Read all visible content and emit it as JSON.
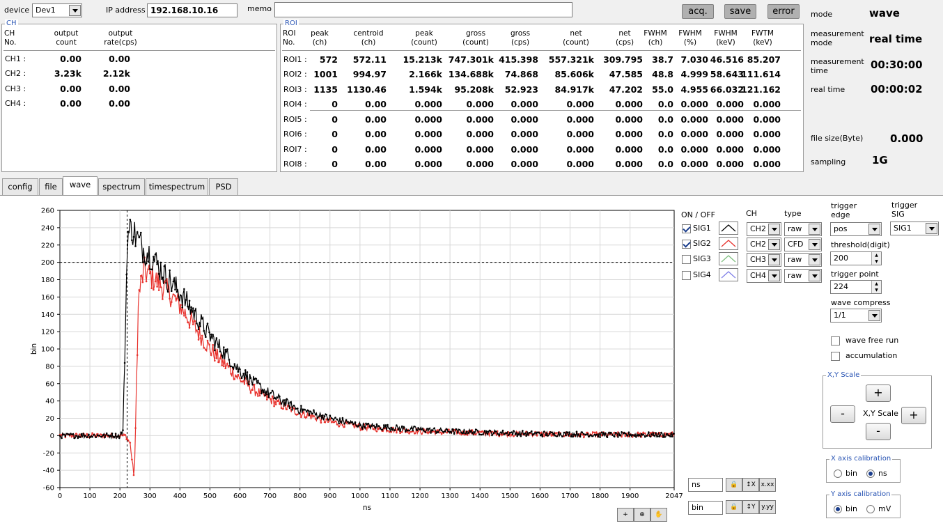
{
  "top": {
    "device_label": "device",
    "device_value": "Dev1",
    "ip_label": "IP address",
    "ip_value": "192.168.10.16",
    "memo_label": "memo",
    "memo_value": "",
    "acq_label": "acq.",
    "save_label": "save",
    "error_label": "error"
  },
  "ch_panel": {
    "title": "CH",
    "h_no": "CH\nNo.",
    "h_count": "output\ncount",
    "h_rate": "output\nrate(cps)",
    "rows": [
      {
        "name": "CH1 :",
        "count": "0.00",
        "rate": "0.00"
      },
      {
        "name": "CH2 :",
        "count": "3.23k",
        "rate": "2.12k"
      },
      {
        "name": "CH3 :",
        "count": "0.00",
        "rate": "0.00"
      },
      {
        "name": "CH4 :",
        "count": "0.00",
        "rate": "0.00"
      }
    ]
  },
  "roi_panel": {
    "title": "ROI",
    "headers": [
      "ROI\nNo.",
      "peak\n(ch)",
      "centroid\n(ch)",
      "peak\n(count)",
      "gross\n(count)",
      "gross\n(cps)",
      "net\n(count)",
      "net\n(cps)",
      "FWHM\n(ch)",
      "FWHM\n(%)",
      "FWHM\n(keV)",
      "FWTM\n(keV)"
    ],
    "rows": [
      [
        "ROI1 :",
        "572",
        "572.11",
        "15.213k",
        "747.301k",
        "415.398",
        "557.321k",
        "309.795",
        "38.7",
        "7.030",
        "46.516",
        "85.207"
      ],
      [
        "ROI2 :",
        "1001",
        "994.97",
        "2.166k",
        "134.688k",
        "74.868",
        "85.606k",
        "47.585",
        "48.8",
        "4.999",
        "58.643",
        "111.614"
      ],
      [
        "ROI3 :",
        "1135",
        "1130.46",
        "1.594k",
        "95.208k",
        "52.923",
        "84.917k",
        "47.202",
        "55.0",
        "4.955",
        "66.032",
        "121.162"
      ],
      [
        "ROI4 :",
        "0",
        "0.00",
        "0.000",
        "0.000",
        "0.000",
        "0.000",
        "0.000",
        "0.0",
        "0.000",
        "0.000",
        "0.000"
      ],
      [
        "ROI5 :",
        "0",
        "0.00",
        "0.000",
        "0.000",
        "0.000",
        "0.000",
        "0.000",
        "0.0",
        "0.000",
        "0.000",
        "0.000"
      ],
      [
        "ROI6 :",
        "0",
        "0.00",
        "0.000",
        "0.000",
        "0.000",
        "0.000",
        "0.000",
        "0.0",
        "0.000",
        "0.000",
        "0.000"
      ],
      [
        "ROI7 :",
        "0",
        "0.00",
        "0.000",
        "0.000",
        "0.000",
        "0.000",
        "0.000",
        "0.0",
        "0.000",
        "0.000",
        "0.000"
      ],
      [
        "ROI8 :",
        "0",
        "0.00",
        "0.000",
        "0.000",
        "0.000",
        "0.000",
        "0.000",
        "0.0",
        "0.000",
        "0.000",
        "0.000"
      ]
    ]
  },
  "status": {
    "mode_label": "mode",
    "mode_value": "wave",
    "meas_mode_label": "measurement\nmode",
    "meas_mode_value": "real time",
    "meas_time_label": "measurement\ntime",
    "meas_time_value": "00:30:00",
    "real_time_label": "real time",
    "real_time_value": "00:00:02",
    "file_size_label": "file size(Byte)",
    "file_size_value": "0.000",
    "sampling_label": "sampling",
    "sampling_value": "1G"
  },
  "tabs": [
    "config",
    "file",
    "wave",
    "spectrum",
    "timespectrum",
    "PSD"
  ],
  "active_tab": "wave",
  "signals": {
    "onoff_label": "ON / OFF",
    "ch_label": "CH",
    "type_label": "type",
    "rows": [
      {
        "name": "SIG1",
        "checked": true,
        "color": "#000000",
        "ch": "CH2",
        "type": "raw"
      },
      {
        "name": "SIG2",
        "checked": true,
        "color": "#e8322d",
        "ch": "CH2",
        "type": "CFD"
      },
      {
        "name": "SIG3",
        "checked": false,
        "color": "#7fbf7f",
        "ch": "CH3",
        "type": "raw"
      },
      {
        "name": "SIG4",
        "checked": false,
        "color": "#8080e8",
        "ch": "CH4",
        "type": "raw"
      }
    ]
  },
  "trigger": {
    "edge_label": "trigger\nedge",
    "edge_value": "pos",
    "sig_label": "trigger\nSIG",
    "sig_value": "SIG1",
    "threshold_label": "threshold(digit)",
    "threshold_value": "200",
    "point_label": "trigger point",
    "point_value": "224",
    "compress_label": "wave compress",
    "compress_value": "1/1",
    "free_run_label": "wave free run",
    "accumulation_label": "accumulation"
  },
  "scale": {
    "title": "X,Y Scale",
    "center_label": "X,Y Scale",
    "plus": "+",
    "minus": "-"
  },
  "x_calib": {
    "title": "X axis calibration",
    "opt1": "bin",
    "opt2": "ns",
    "selected": "ns"
  },
  "y_calib": {
    "title": "Y axis calibration",
    "opt1": "bin",
    "opt2": "mV",
    "selected": "bin"
  },
  "axis_units": {
    "x": "ns",
    "y": "bin"
  },
  "chart_data": {
    "type": "line",
    "xlabel": "ns",
    "ylabel": "bin",
    "xlim": [
      0,
      2047
    ],
    "ylim": [
      -60,
      260
    ],
    "xticks": [
      0,
      100,
      200,
      300,
      400,
      500,
      600,
      700,
      800,
      900,
      1000,
      1100,
      1200,
      1300,
      1400,
      1500,
      1600,
      1700,
      1800,
      1900,
      2047
    ],
    "yticks": [
      -60,
      -40,
      -20,
      0,
      20,
      40,
      60,
      80,
      100,
      120,
      140,
      160,
      180,
      200,
      220,
      240,
      260
    ],
    "grid": true,
    "cursor_x": 224,
    "cursor_y": 200,
    "series": [
      {
        "name": "SIG1",
        "color": "#000000",
        "x": [
          0,
          200,
          210,
          218,
          225,
          240,
          260,
          280,
          300,
          350,
          400,
          450,
          500,
          550,
          600,
          650,
          700,
          750,
          800,
          900,
          1000,
          1100,
          1200,
          1300,
          1400,
          1500,
          1600,
          1700,
          1800,
          1900,
          2047
        ],
        "y": [
          0,
          0,
          5,
          120,
          230,
          240,
          225,
          215,
          210,
          185,
          165,
          140,
          115,
          95,
          75,
          60,
          48,
          38,
          30,
          20,
          12,
          9,
          7,
          5,
          4,
          3,
          2,
          2,
          1,
          1,
          1
        ]
      },
      {
        "name": "SIG2",
        "color": "#e8322d",
        "x": [
          0,
          220,
          235,
          245,
          250,
          255,
          262,
          270,
          280,
          300,
          350,
          400,
          450,
          500,
          550,
          600,
          650,
          700,
          750,
          800,
          900,
          1000,
          1100,
          1200,
          1300,
          1400,
          1500,
          1600,
          1700,
          1800,
          1900,
          2047
        ],
        "y": [
          0,
          0,
          -10,
          -45,
          -30,
          60,
          160,
          175,
          190,
          185,
          170,
          150,
          125,
          100,
          82,
          65,
          52,
          42,
          33,
          26,
          16,
          10,
          7,
          5,
          4,
          3,
          2,
          2,
          1,
          1,
          1,
          1
        ]
      }
    ]
  }
}
